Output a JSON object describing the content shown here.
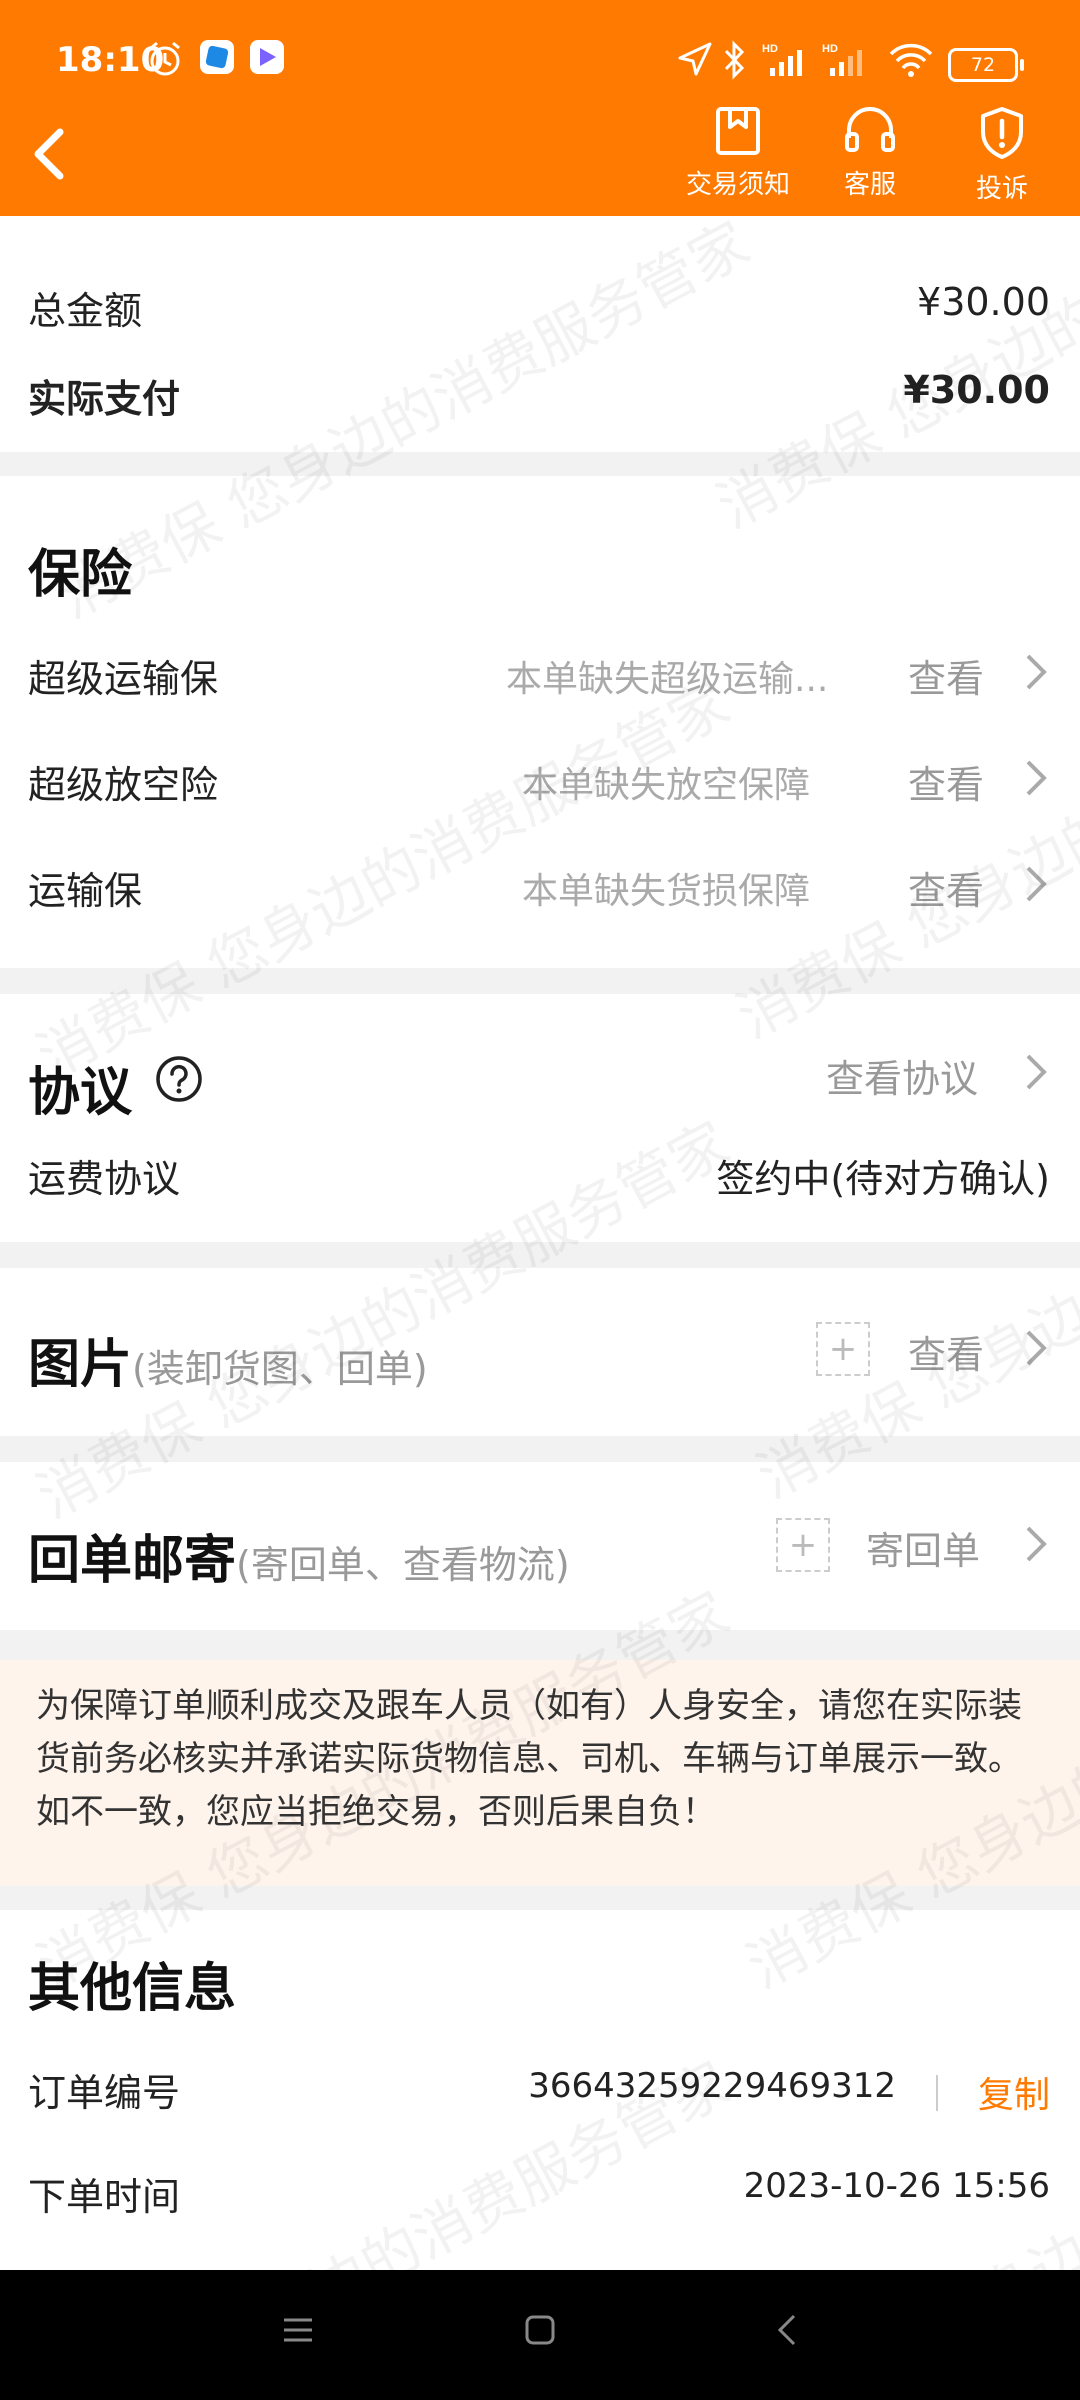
{
  "status_bar": {
    "time": "18:10",
    "battery": "72",
    "network": "HD"
  },
  "header": {
    "back_icon": "chevron-left-icon",
    "actions": [
      {
        "label": "交易须知",
        "icon": "bookmark-icon"
      },
      {
        "label": "客服",
        "icon": "headset-icon"
      },
      {
        "label": "投诉",
        "icon": "shield-alert-icon"
      }
    ],
    "bg_color": "#ff7a00"
  },
  "fees": {
    "total_label": "总金额",
    "total_value": "¥30.00",
    "paid_label": "实际支付",
    "paid_value": "¥30.00"
  },
  "insurance": {
    "title": "保险",
    "items": [
      {
        "label": "超级运输保",
        "hint": "本单缺失超级运输...",
        "action": "查看"
      },
      {
        "label": "超级放空险",
        "hint": "本单缺失放空保障",
        "action": "查看"
      },
      {
        "label": "运输保",
        "hint": "本单缺失货损保障",
        "action": "查看"
      }
    ]
  },
  "agreement": {
    "title": "协议",
    "view_label": "查看协议",
    "freight_label": "运费协议",
    "freight_status": "签约中(待对方确认)"
  },
  "photos": {
    "title": "图片",
    "subtitle": "(装卸货图、回单)",
    "plus": "+",
    "action": "查看"
  },
  "receipt_mail": {
    "title": "回单邮寄",
    "subtitle": "(寄回单、查看物流)",
    "plus": "+",
    "action": "寄回单"
  },
  "notice": {
    "text": "为保障订单顺利成交及跟车人员（如有）人身安全，请您在实际装货前务必核实并承诺实际货物信息、司机、车辆与订单展示一致。如不一致，您应当拒绝交易，否则后果自负！"
  },
  "other_info": {
    "title": "其他信息",
    "order_no_label": "订单编号",
    "order_no": "36643259229469312",
    "copy_label": "复制",
    "order_time_label": "下单时间",
    "order_time": "2023-10-26 15:56"
  },
  "watermark": {
    "text": "消费保 您身边的消费服务管家"
  },
  "nav": {
    "icons": [
      "menu-icon",
      "home-square-icon",
      "back-icon"
    ]
  }
}
